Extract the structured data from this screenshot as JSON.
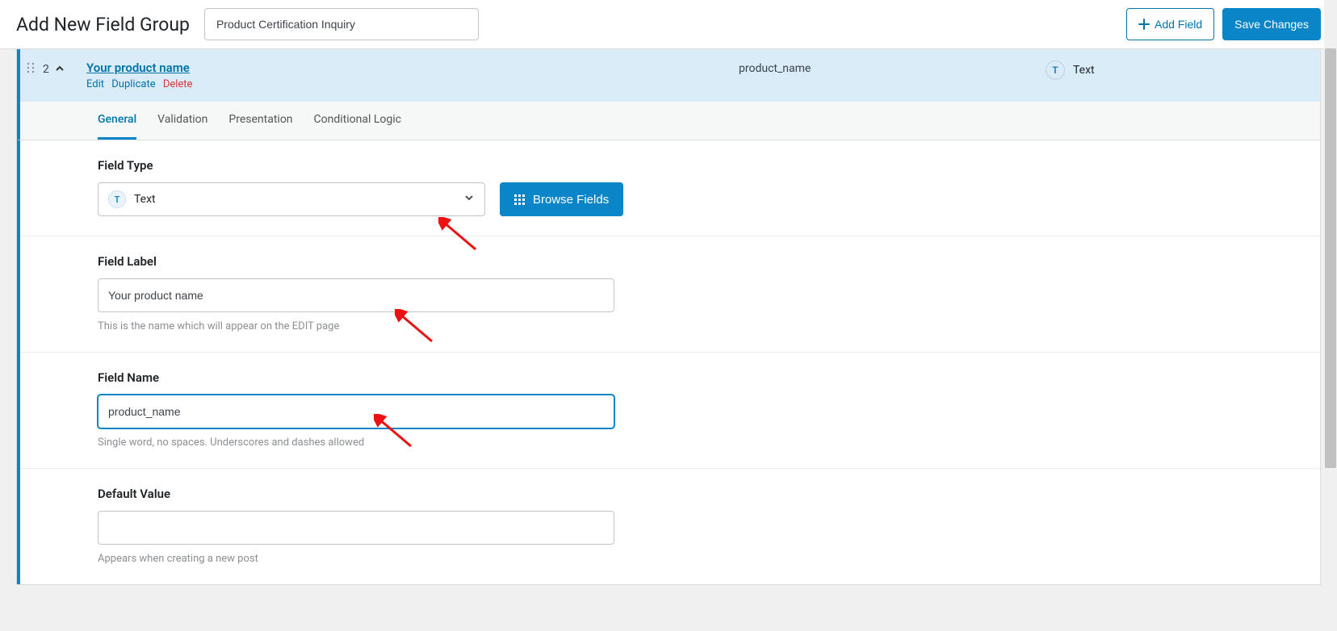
{
  "header": {
    "page_title": "Add New Field Group",
    "group_title_value": "Product Certification Inquiry",
    "add_field_label": "Add Field",
    "save_changes_label": "Save Changes"
  },
  "field_row": {
    "order": "2",
    "label": "Your product name",
    "actions": {
      "edit": "Edit",
      "duplicate": "Duplicate",
      "delete": "Delete"
    },
    "name": "product_name",
    "type_label": "Text"
  },
  "tabs": {
    "general": "General",
    "validation": "Validation",
    "presentation": "Presentation",
    "conditional": "Conditional Logic"
  },
  "settings": {
    "field_type": {
      "label": "Field Type",
      "value": "Text",
      "browse_label": "Browse Fields"
    },
    "field_label": {
      "label": "Field Label",
      "value": "Your product name",
      "help": "This is the name which will appear on the EDIT page"
    },
    "field_name": {
      "label": "Field Name",
      "value": "product_name",
      "help": "Single word, no spaces. Underscores and dashes allowed"
    },
    "default_value": {
      "label": "Default Value",
      "value": "",
      "help": "Appears when creating a new post"
    }
  }
}
